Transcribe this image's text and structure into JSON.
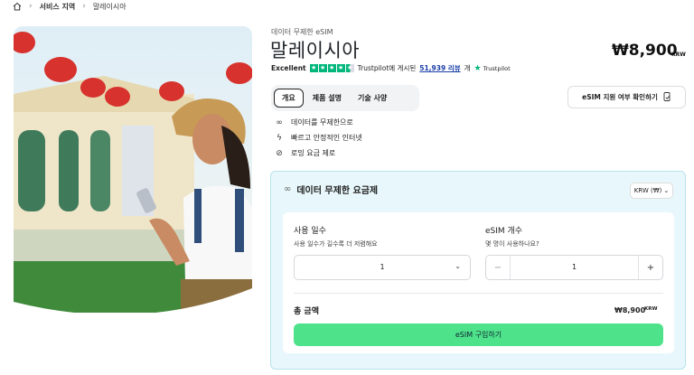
{
  "breadcrumb": {
    "item1": "서비스 지역",
    "item2": "말레이시아"
  },
  "product": {
    "subtitle": "데이터 무제한 eSIM",
    "title": "말레이시아",
    "price": "₩8,900",
    "price_currency": "KRW"
  },
  "trustpilot": {
    "rating_label": "Excellent",
    "text_before": "Trustpilot에 게시된",
    "reviews_link": "51,939 리뷰",
    "text_after": "개",
    "logo_text": "Trustpilot",
    "rating_stars": 4.5
  },
  "tabs": [
    {
      "label": "개요",
      "active": true
    },
    {
      "label": "제품 설명",
      "active": false
    },
    {
      "label": "기술 사양",
      "active": false
    }
  ],
  "compat_button": "eSIM 지원 여부 확인하기",
  "features": [
    {
      "icon": "infinity-icon",
      "text": "데이터를 무제한으로"
    },
    {
      "icon": "lightning-icon",
      "text": "빠르고 안정적인 인터넷"
    },
    {
      "icon": "no-roaming-icon",
      "text": "로밍 요금 제로"
    }
  ],
  "plan": {
    "title": "데이터 무제한 요금제",
    "currency_select": "KRW (₩)",
    "days_label": "사용 일수",
    "days_hint": "사용 일수가 길수록 더 저렴해요",
    "days_value": "1",
    "esim_label": "eSIM 개수",
    "esim_hint": "몇 명이 사용하나요?",
    "esim_value": "1",
    "total_label": "총 금액",
    "total_value": "₩8,900",
    "total_currency": "KRW",
    "buy_button": "eSIM 구입하기"
  },
  "colors": {
    "accent_green": "#4ee38a",
    "trustpilot_green": "#00b67a",
    "plan_bg": "#e8f7fb"
  }
}
